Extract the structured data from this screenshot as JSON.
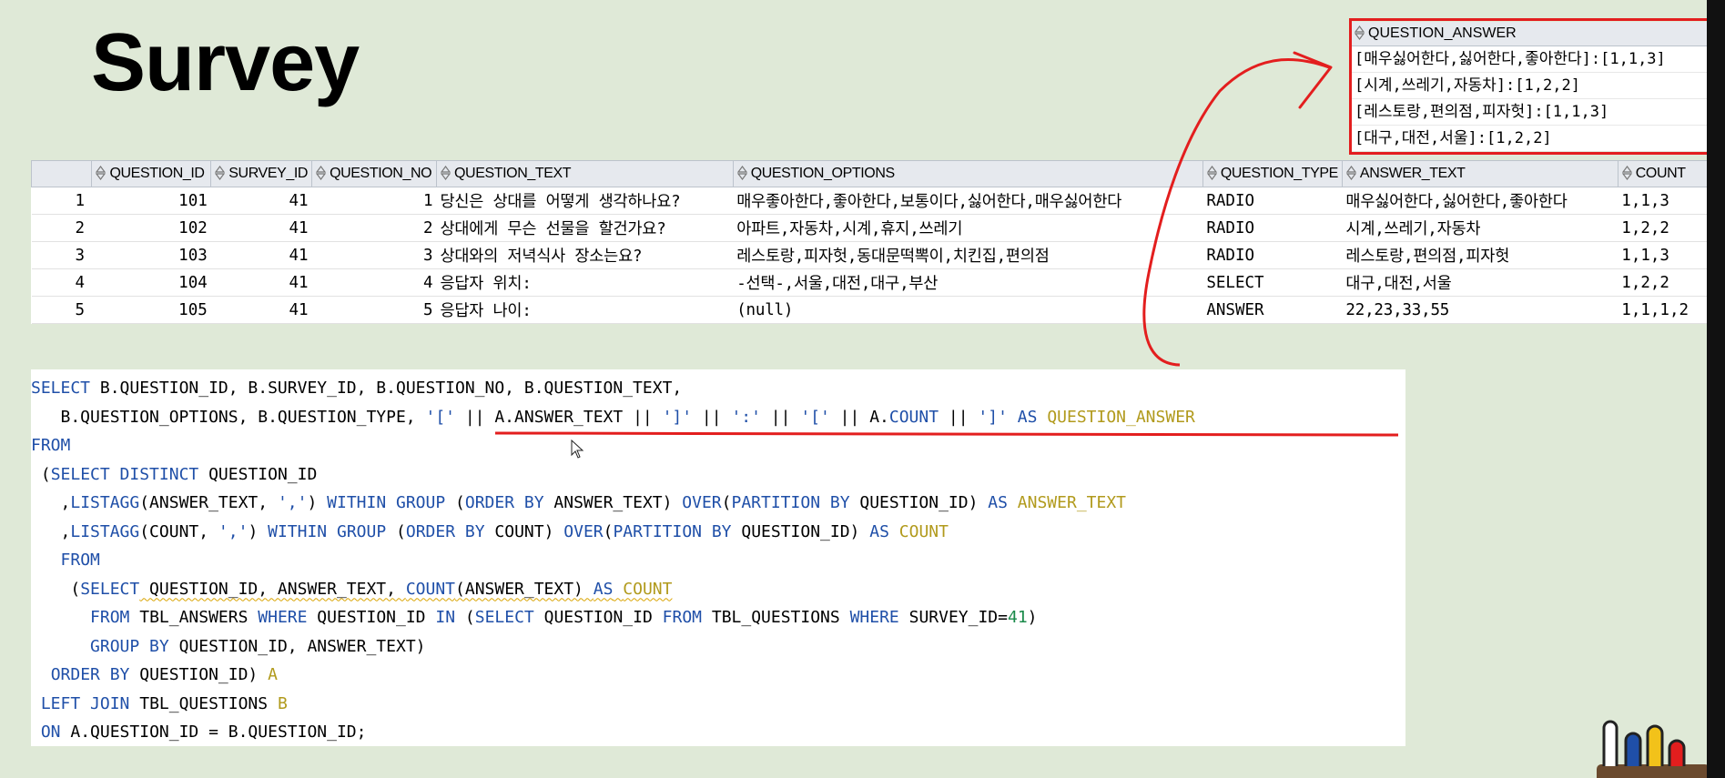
{
  "title": "Survey",
  "grid": {
    "columns": [
      "",
      "QUESTION_ID",
      "SURVEY_ID",
      "QUESTION_NO",
      "QUESTION_TEXT",
      "QUESTION_OPTIONS",
      "QUESTION_TYPE",
      "ANSWER_TEXT",
      "COUNT"
    ],
    "rows": [
      [
        "1",
        "101",
        "41",
        "1",
        "당신은 상대를 어떻게 생각하나요?",
        "매우좋아한다,좋아한다,보통이다,싫어한다,매우싫어한다",
        "RADIO",
        "매우싫어한다,싫어한다,좋아한다",
        "1,1,3"
      ],
      [
        "2",
        "102",
        "41",
        "2",
        "상대에게 무슨 선물을 할건가요?",
        "아파트,자동차,시계,휴지,쓰레기",
        "RADIO",
        "시계,쓰레기,자동차",
        "1,2,2"
      ],
      [
        "3",
        "103",
        "41",
        "3",
        "상대와의 저녁식사 장소는요?",
        "레스토랑,피자헛,동대문떡뽁이,치킨집,편의점",
        "RADIO",
        "레스토랑,편의점,피자헛",
        "1,1,3"
      ],
      [
        "4",
        "104",
        "41",
        "4",
        "응답자 위치:",
        "-선택-,서울,대전,대구,부산",
        "SELECT",
        "대구,대전,서울",
        "1,2,2"
      ],
      [
        "5",
        "105",
        "41",
        "5",
        "응답자 나이:",
        "(null)",
        "ANSWER",
        "22,23,33,55",
        "1,1,1,2"
      ]
    ]
  },
  "qa_result": {
    "header": "QUESTION_ANSWER",
    "rows": [
      "[매우싫어한다,싫어한다,좋아한다]:[1,1,3]",
      "[시계,쓰레기,자동차]:[1,2,2]",
      "[레스토랑,편의점,피자헛]:[1,1,3]",
      "[대구,대전,서울]:[1,2,2]"
    ]
  },
  "sql": {
    "l1": {
      "a": "SELECT",
      "b": " B.QUESTION_ID, B.SURVEY_ID, B.QUESTION_NO, B.QUESTION_TEXT,"
    },
    "l2": {
      "a": "   B.QUESTION_OPTIONS, B.QUESTION_TYPE, ",
      "s1": "'['",
      "o1": " || A.ANSWER_TEXT || ",
      "s2": "']'",
      "o2": " || ",
      "s3": "':'",
      "o3": " || ",
      "s4": "'['",
      "o4": " || A.",
      "c": "COUNT",
      "o5": " || ",
      "s5": "']'",
      "o6": " ",
      "as": "AS",
      "sp": " ",
      "alias": "QUESTION_ANSWER"
    },
    "l3": {
      "a": "FROM"
    },
    "l4": {
      "pre": " (",
      "kw": "SELECT DISTINCT",
      "rest": " QUESTION_ID"
    },
    "l5": {
      "pre": "   ,",
      "f": "LISTAGG",
      "p1": "(ANSWER_TEXT, ",
      "s": "','",
      "p2": ") ",
      "k1": "WITHIN GROUP",
      "p3": " (",
      "k2": "ORDER BY",
      "p4": " ANSWER_TEXT) ",
      "k3": "OVER",
      "p5": "(",
      "k4": "PARTITION BY",
      "p6": " QUESTION_ID) ",
      "k5": "AS",
      "p7": " ",
      "al": "ANSWER_TEXT"
    },
    "l6": {
      "pre": "   ,",
      "f": "LISTAGG",
      "p1": "(COUNT, ",
      "s": "','",
      "p2": ") ",
      "k1": "WITHIN GROUP",
      "p3": " (",
      "k2": "ORDER BY",
      "p4": " COUNT) ",
      "k3": "OVER",
      "p5": "(",
      "k4": "PARTITION BY",
      "p6": " QUESTION_ID) ",
      "k5": "AS",
      "p7": " ",
      "al": "COUNT"
    },
    "l7": {
      "pre": "   ",
      "kw": "FROM"
    },
    "l8": {
      "pre": "    (",
      "kw": "SELECT",
      "rest": " QUESTION_ID, ANSWER_TEXT, ",
      "fn": "COUNT",
      "rest2": "(ANSWER_TEXT) ",
      "as": "AS",
      "sp": " ",
      "al": "COUNT"
    },
    "l9": {
      "pre": "      ",
      "k1": "FROM",
      "p1": " TBL_ANSWERS ",
      "k2": "WHERE",
      "p2": " QUESTION_ID ",
      "k3": "IN",
      "p3": " (",
      "k4": "SELECT",
      "p4": " QUESTION_ID ",
      "k5": "FROM",
      "p5": " TBL_QUESTIONS ",
      "k6": "WHERE",
      "p6": " SURVEY_ID=",
      "n": "41",
      "p7": ")"
    },
    "l10": {
      "pre": "      ",
      "kw": "GROUP BY",
      "rest": " QUESTION_ID, ANSWER_TEXT)"
    },
    "l11": {
      "pre": "  ",
      "kw": "ORDER BY",
      "rest": " QUESTION_ID) ",
      "al": "A"
    },
    "l12": {
      "pre": " ",
      "kw": "LEFT JOIN",
      "rest": " TBL_QUESTIONS ",
      "al": "B"
    },
    "l13": {
      "pre": " ",
      "kw": "ON",
      "rest": " A.QUESTION_ID = B.QUESTION_ID;"
    }
  },
  "colors": {
    "keyword": "#1f4fa8",
    "alias": "#b19a1c",
    "number": "#1a8a4a",
    "annotation": "#e31e1e",
    "background": "#dfe9d7"
  }
}
